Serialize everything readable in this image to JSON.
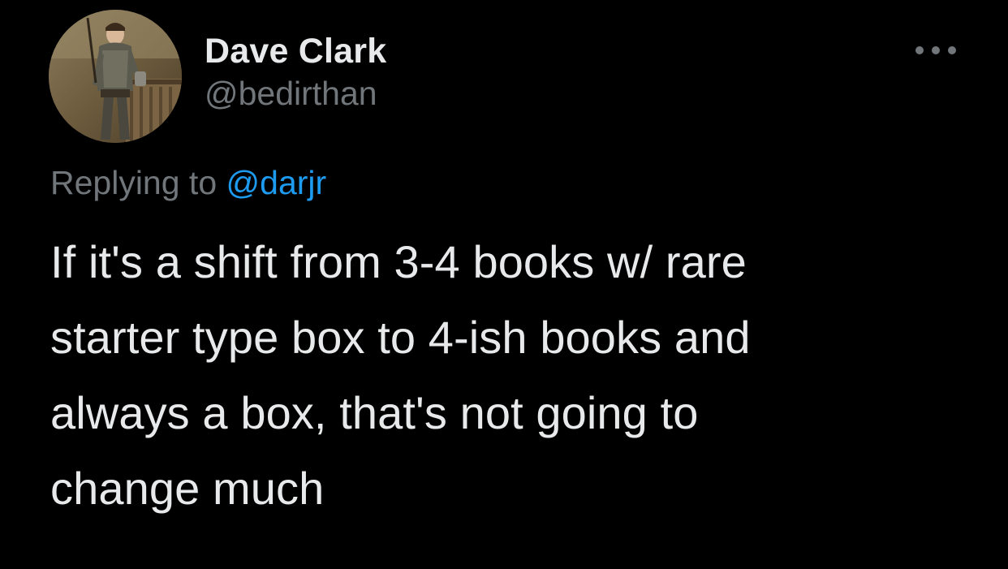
{
  "author": {
    "display_name": "Dave Clark",
    "handle": "@bedirthan",
    "avatar_icon": "profile-photo-avatar"
  },
  "reply": {
    "prefix": "Replying to",
    "mention": "@darjr"
  },
  "tweet": {
    "lines": [
      "If it's a shift from 3-4 books w/ rare",
      "starter type box to 4-ish books and",
      "always a box, that's not going to",
      "change much"
    ]
  },
  "menu": {
    "icon": "more-options-icon"
  },
  "colors": {
    "background": "#000000",
    "primary_text": "#e7e9ea",
    "secondary_text": "#71767b",
    "accent": "#1d9bf0"
  }
}
